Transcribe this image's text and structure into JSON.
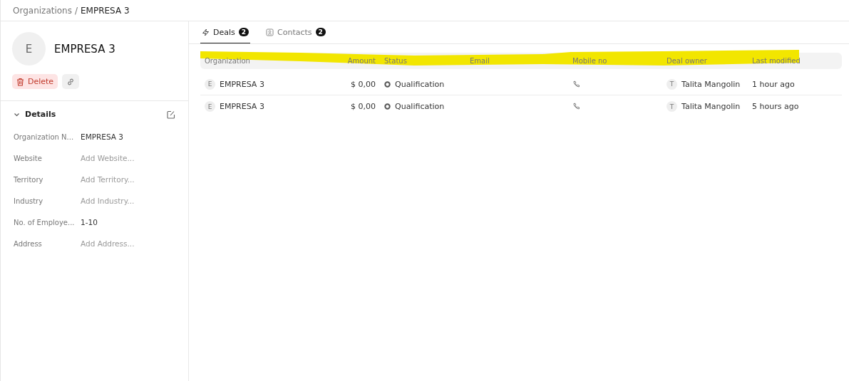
{
  "breadcrumb": {
    "parent": "Organizations",
    "separator": "/",
    "current": "EMPRESA 3"
  },
  "organization": {
    "initial": "E",
    "name": "EMPRESA 3",
    "delete_label": "Delete"
  },
  "details": {
    "title": "Details",
    "expanded": true,
    "fields": [
      {
        "label": "Organization N...",
        "value": "EMPRESA 3"
      },
      {
        "label": "Website",
        "placeholder": "Add Website..."
      },
      {
        "label": "Territory",
        "placeholder": "Add Territory..."
      },
      {
        "label": "Industry",
        "placeholder": "Add Industry..."
      },
      {
        "label": "No. of Employe...",
        "value": "1-10"
      },
      {
        "label": "Address",
        "placeholder": "Add Address..."
      }
    ]
  },
  "tabs": [
    {
      "label": "Deals",
      "count": "2",
      "kind": "deals",
      "selected": true
    },
    {
      "label": "Contacts",
      "count": "2",
      "kind": "contacts",
      "selected": false
    }
  ],
  "table": {
    "columns": [
      "Organization",
      "Amount",
      "Status",
      "Email",
      "Mobile no",
      "Deal owner",
      "Last modified"
    ],
    "rows": [
      {
        "org_initial": "E",
        "organization": "EMPRESA 3",
        "amount": "$ 0,00",
        "status": "Qualification",
        "owner_initial": "T",
        "deal_owner": "Talita Mangolin",
        "last_modified": "1 hour ago"
      },
      {
        "org_initial": "E",
        "organization": "EMPRESA 3",
        "amount": "$ 0,00",
        "status": "Qualification",
        "owner_initial": "T",
        "deal_owner": "Talita Mangolin",
        "last_modified": "5 hours ago"
      }
    ]
  }
}
